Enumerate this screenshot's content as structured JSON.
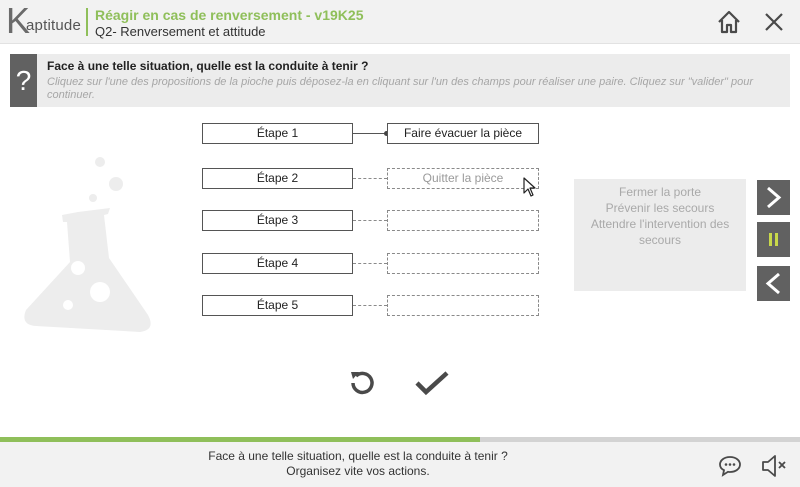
{
  "header": {
    "logo_initial": "K",
    "logo_rest": "aptitude",
    "module_title": "Réagir en cas de renversement - v19K25",
    "subtitle": "Q2- Renversement et attitude",
    "home_icon": "home-icon",
    "close_icon": "close-icon"
  },
  "question": {
    "mark": "?",
    "title": "Face à une telle situation, quelle est la conduite à tenir ?",
    "instruction": "Cliquez sur l'une des propositions de la pioche puis déposez-la en cliquant sur l'un des champs pour réaliser une paire. Cliquez sur \"valider\" pour continuer."
  },
  "steps": [
    {
      "label": "Étape 1",
      "answer": "Faire évacuer la pièce",
      "state": "filled"
    },
    {
      "label": "Étape 2",
      "answer": "Quitter la pièce",
      "state": "hover"
    },
    {
      "label": "Étape 3",
      "answer": "",
      "state": "empty"
    },
    {
      "label": "Étape 4",
      "answer": "",
      "state": "empty"
    },
    {
      "label": "Étape 5",
      "answer": "",
      "state": "empty"
    }
  ],
  "pioche": {
    "items": [
      "Fermer la porte",
      "Prévenir les secours",
      "Attendre l'intervention des secours"
    ]
  },
  "side_nav": {
    "next_icon": "chevron-right-icon",
    "pause_icon": "pause-icon",
    "prev_icon": "chevron-left-icon"
  },
  "actions": {
    "reset_icon": "reset-icon",
    "validate_icon": "checkmark-icon"
  },
  "progress": {
    "fraction": 0.6
  },
  "footer": {
    "line1": "Face à une telle situation, quelle est la conduite à tenir ?",
    "line2": "Organisez vite vos actions.",
    "chat_icon": "chat-icon",
    "sound_icon": "sound-icon"
  },
  "colors": {
    "accent_green": "#8fbf5a",
    "dark_gray": "#616161",
    "panel_gray": "#ececec"
  }
}
